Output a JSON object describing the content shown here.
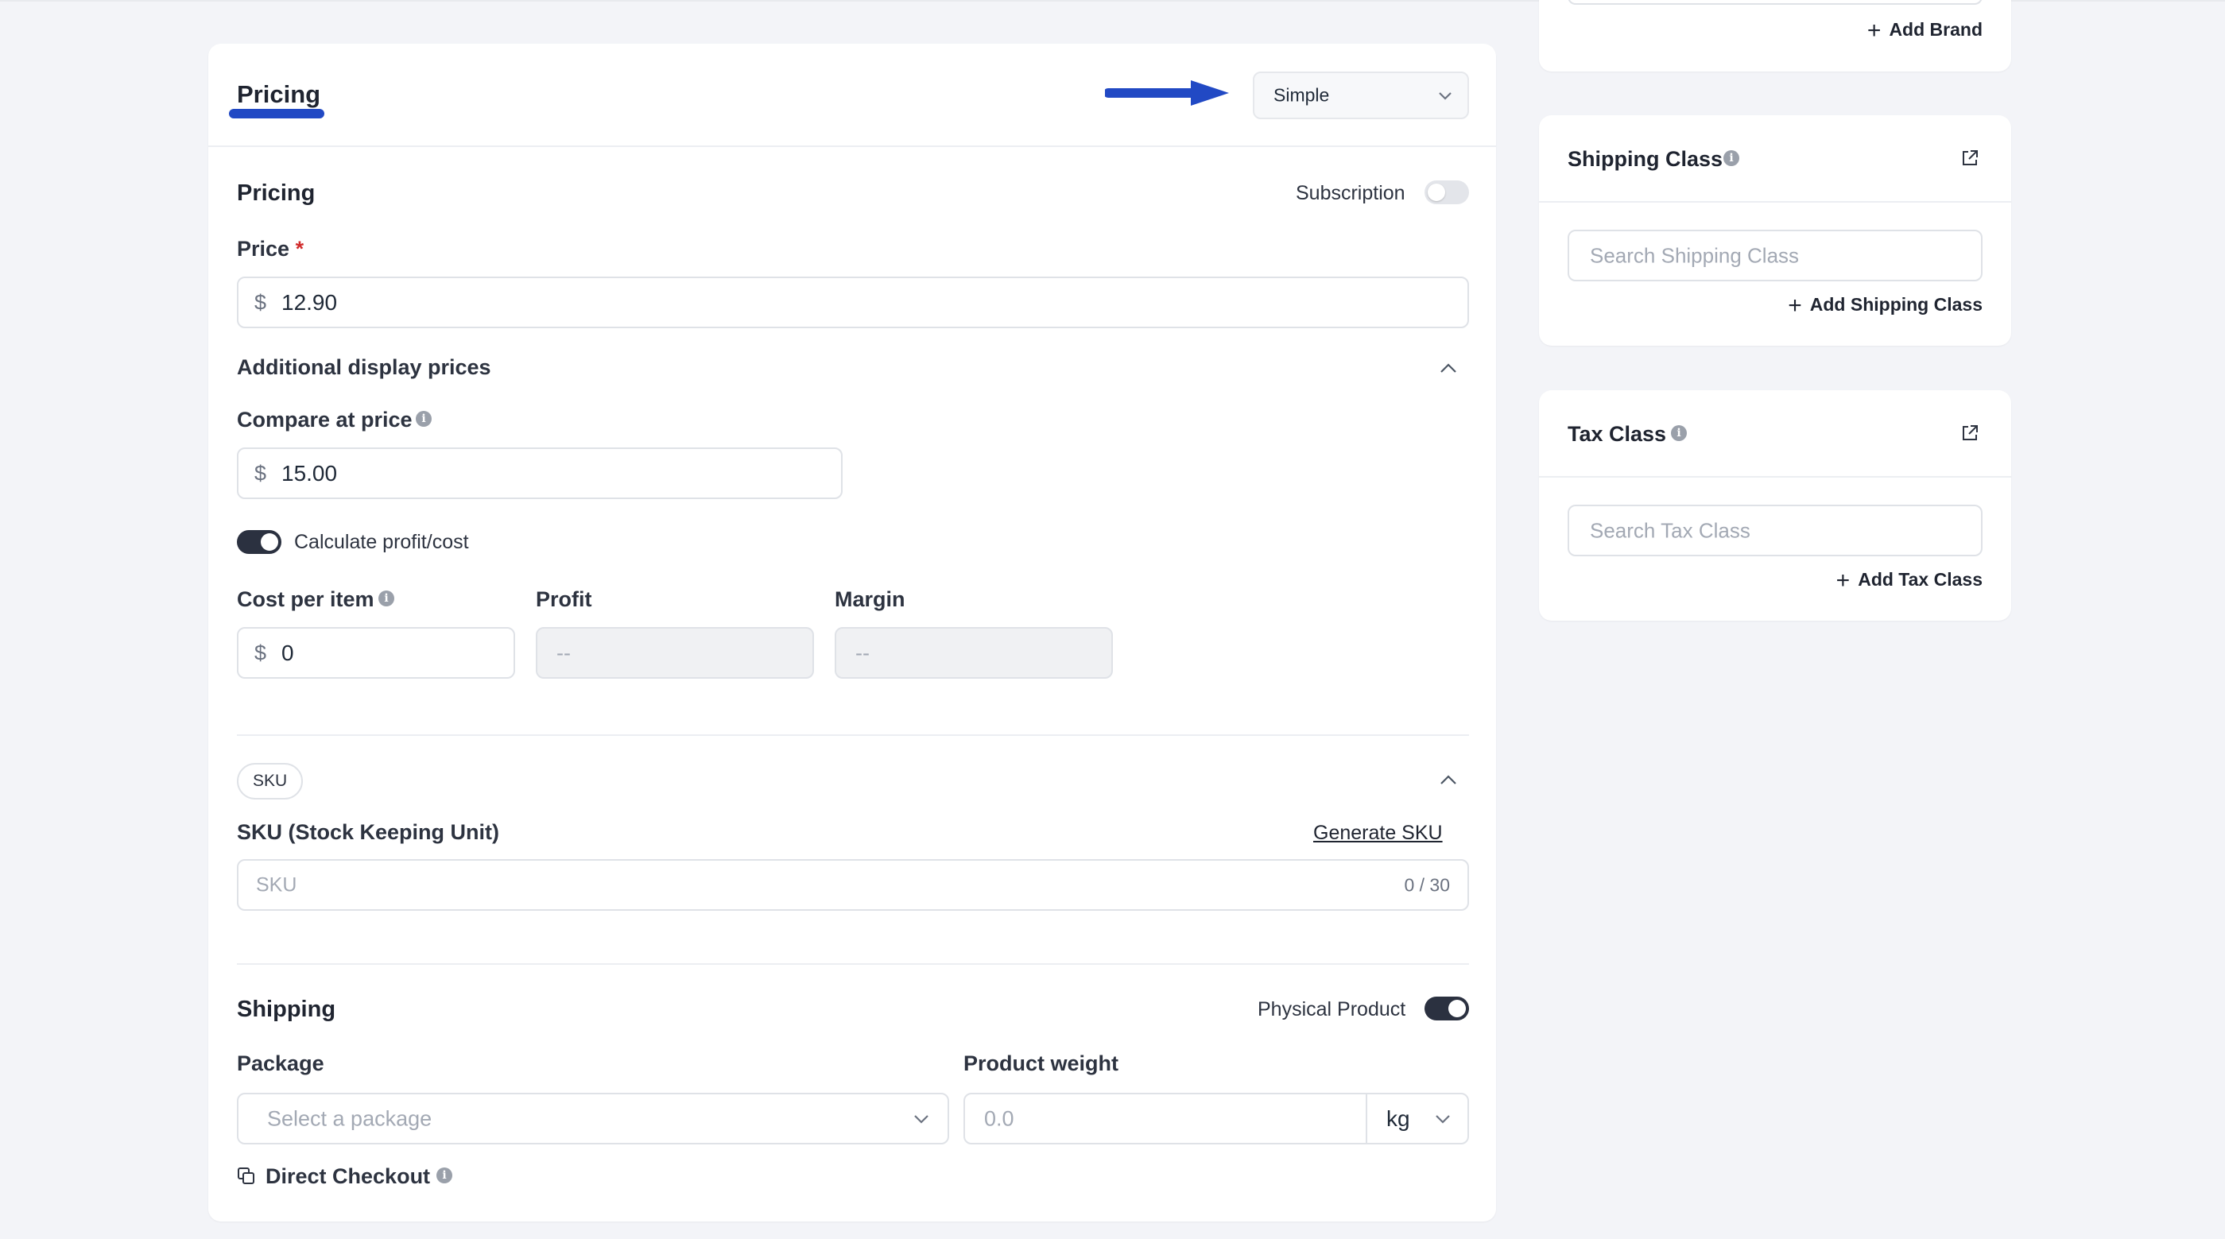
{
  "header": {
    "tab_label": "Pricing",
    "type_select_value": "Simple"
  },
  "pricing": {
    "section_title": "Pricing",
    "subscription_label": "Subscription",
    "subscription_on": false,
    "price_label": "Price",
    "required_mark": "*",
    "currency_symbol": "$",
    "price_value": "12.90",
    "additional_title": "Additional display prices",
    "compare_label": "Compare at price",
    "compare_value": "15.00",
    "calc_label": "Calculate profit/cost",
    "calc_on": true,
    "cost_label": "Cost per item",
    "cost_value": "0",
    "profit_label": "Profit",
    "profit_placeholder": "--",
    "margin_label": "Margin",
    "margin_placeholder": "--"
  },
  "sku": {
    "badge": "SKU",
    "field_label": "SKU (Stock Keeping Unit)",
    "generate_link": "Generate SKU",
    "placeholder": "SKU",
    "counter": "0 / 30"
  },
  "shipping": {
    "title": "Shipping",
    "physical_label": "Physical Product",
    "physical_on": true,
    "package_label": "Package",
    "package_placeholder": "Select a package",
    "weight_label": "Product weight",
    "weight_placeholder": "0.0",
    "weight_unit": "kg",
    "direct_checkout_label": "Direct Checkout"
  },
  "sidebar": {
    "brand_add": "Add Brand",
    "shipping_class": {
      "title": "Shipping Class",
      "search_placeholder": "Search Shipping Class",
      "add_label": "Add Shipping Class"
    },
    "tax_class": {
      "title": "Tax Class",
      "search_placeholder": "Search Tax Class",
      "add_label": "Add Tax Class"
    }
  },
  "colors": {
    "accent_blue": "#2149c4",
    "required_red": "#d12c2c",
    "toggle_on": "#2b3140"
  }
}
